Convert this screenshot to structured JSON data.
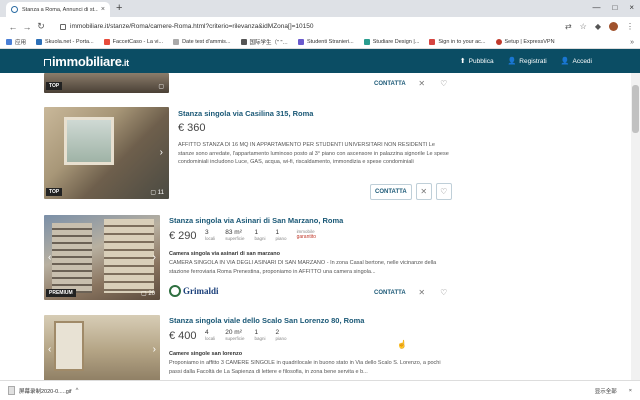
{
  "browser": {
    "tab_title": "Stanza a Roma, Annunci di st...",
    "tab_close": "×",
    "new_tab": "+",
    "url": "immobiliare.it/stanze/Roma/camere-Roma.html?criterio=rilevanza&idMZona[]=10150",
    "window_controls": [
      "—",
      "□",
      "×"
    ],
    "bookmarks": [
      "应用",
      "Skuola.net - Porta...",
      "FaccetCaso - La vi...",
      "Date test d'ammis...",
      "国际学生（\" \"…",
      "Studenti Stranieri...",
      "Studiare Design |...",
      "Sign in to your ac...",
      "Setup | ExpressVPN"
    ],
    "bookmarks_more": "»"
  },
  "header": {
    "logo": "immobiliare",
    "logo_suffix": ".it",
    "links": [
      {
        "icon": "pin-icon",
        "label": "Pubblica"
      },
      {
        "icon": "user-plus-icon",
        "label": "Registrati"
      },
      {
        "icon": "user-icon",
        "label": "Accedi"
      }
    ]
  },
  "listings": [
    {
      "badge": "TOP",
      "photo_count": "",
      "contact": "CONTATTA"
    },
    {
      "title": "Stanza singola via Casilina 315, Roma",
      "price": "€ 360",
      "description": "AFFITTO STANZA DI 16 MQ IN APPARTAMENTO PER STUDENTI UNIVERSITARI NON RESIDENTI Le stanze sono arredate, l'appartamento luminoso posto al 3° piano con ascensore in palazzina signorile Le spese condominiali includono Luce, GAS, acqua, wi-fi, riscaldamento, immondizia e spese condominiali",
      "badge": "TOP",
      "photo_count": "11",
      "contact": "CONTATTA"
    },
    {
      "title": "Stanza singola via Asinari di San Marzano, Roma",
      "price": "€ 290",
      "features": [
        {
          "value": "3",
          "label": "locali"
        },
        {
          "value": "83 m²",
          "label": "superficie"
        },
        {
          "value": "1",
          "label": "bagni"
        },
        {
          "value": "1",
          "label": "piano"
        },
        {
          "value": "immobile",
          "label": "garantito"
        }
      ],
      "subtitle": "Camera singola via asinari di san marzano",
      "description": "CAMERA SINGOLA IN VIA DEGLI ASINARI DI SAN MARZANO - In zona Casal bertone, nelle vicinanze della stazione ferroviaria Roma Prenestina, proponiamo in AFFITTO una camera singola...",
      "badge": "PREMIUM",
      "photo_count": "20",
      "agency": "Grimaldi",
      "contact": "CONTATTA"
    },
    {
      "title": "Stanza singola viale dello Scalo San Lorenzo 80, Roma",
      "price": "€ 400",
      "features": [
        {
          "value": "4",
          "label": "locali"
        },
        {
          "value": "20 m²",
          "label": "superficie"
        },
        {
          "value": "1",
          "label": "bagni"
        },
        {
          "value": "2",
          "label": "piano"
        }
      ],
      "subtitle": "Camere singole san lorenzo",
      "description": "Proponiamo in affitto 3 CAMERE SINGOLE in quadrilocale in buono stato in Via dello Scalo S. Lorenzo, a pochi passi dalla Facoltà de La Sapienza di lettere e filosofia, in zona bene servita e b..."
    }
  ],
  "download_bar": {
    "file_name": "屏幕录制2020-0.....gif",
    "show_all": "显示全部",
    "close": "×"
  },
  "colors": {
    "header_bg": "#0b4d64",
    "title_link": "#1a5876",
    "guaranteed": "#c0392b"
  }
}
